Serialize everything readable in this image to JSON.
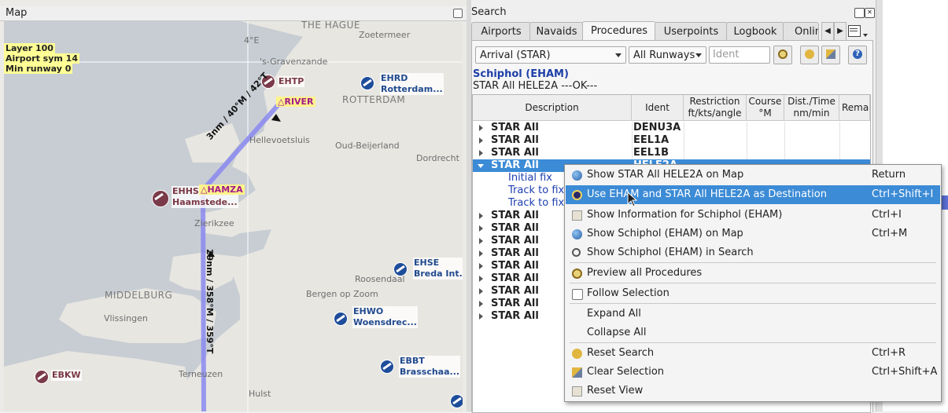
{
  "map": {
    "title": "Map",
    "info": [
      "Layer 100",
      "Airport sym 14",
      "Min runway 0"
    ],
    "grid_label": "4°E",
    "cities": [
      "THE HAGUE",
      "ROTTERDAM",
      "MIDDELBURG"
    ],
    "places": [
      "Zoetermeer",
      "'s-Gravenzande",
      "Hellevoetsluis",
      "Oud-Beijerland",
      "Dordrecht",
      "Zierikzee",
      "Roosendaal",
      "Bergen op Zoom",
      "Vlissingen",
      "Terneuzen",
      "Hulst"
    ],
    "airports": [
      {
        "code": "EHTP",
        "name": ""
      },
      {
        "code": "EHRD",
        "name": "Rotterdam..."
      },
      {
        "code": "EHHS",
        "name": "Haamstede..."
      },
      {
        "code": "EHSE",
        "name": "Breda Int..."
      },
      {
        "code": "EHWO",
        "name": "Woensdrec..."
      },
      {
        "code": "EBBT",
        "name": "Brasschaa..."
      },
      {
        "code": "EBKW",
        "name": ""
      }
    ],
    "waypoints": [
      "RIVER",
      "HAMZA"
    ],
    "legs": [
      "3nm / 40°M / 42°T",
      "29nm / 358°M / 359°T"
    ]
  },
  "search": {
    "title": "Search",
    "tabs": [
      "Airports",
      "Navaids",
      "Procedures",
      "Userpoints",
      "Logbook",
      "Online"
    ],
    "active_tab": "Procedures",
    "filter_type": "Arrival (STAR)",
    "filter_runways": "All Runways",
    "ident_placeholder": "Ident",
    "airport_heading": "Schiphol (EHAM)",
    "status_line": "STAR All HELE2A  ---OK---",
    "columns": [
      "Description",
      "Ident",
      "Restriction ft/kts/angle",
      "Course °M",
      "Dist./Time nm/min",
      "Remar"
    ],
    "rows": [
      {
        "desc": "STAR  All",
        "ident": "DENU3A"
      },
      {
        "desc": "STAR  All",
        "ident": "EEL1A"
      },
      {
        "desc": "STAR  All",
        "ident": "EEL1B"
      },
      {
        "desc": "STAR  All",
        "ident": "HELE2A"
      }
    ],
    "subrows": [
      "Initial fix",
      "Track to fix",
      "Track to fix"
    ],
    "more_rows": [
      "STAR  All",
      "STAR  All",
      "STAR  All",
      "STAR  All",
      "STAR  All",
      "STAR  All",
      "STAR  All",
      "STAR  All",
      "STAR  All"
    ]
  },
  "context_menu": {
    "items": [
      {
        "label": "Show STAR All HELE2A on Map",
        "shortcut": "Return"
      },
      {
        "label": "Use EHAM and STAR All HELE2A as Destination",
        "shortcut": "Ctrl+Shift+I"
      },
      {
        "label": "Show Information for Schiphol (EHAM)",
        "shortcut": "Ctrl+I"
      },
      {
        "label": "Show Schiphol (EHAM) on Map",
        "shortcut": "Ctrl+M"
      },
      {
        "label": "Show Schiphol (EHAM) in Search",
        "shortcut": ""
      },
      {
        "label": "Preview all Procedures",
        "shortcut": ""
      },
      {
        "label": "Follow Selection",
        "shortcut": ""
      },
      {
        "label": "Expand All",
        "shortcut": ""
      },
      {
        "label": "Collapse All",
        "shortcut": ""
      },
      {
        "label": "Reset Search",
        "shortcut": "Ctrl+R"
      },
      {
        "label": "Clear Selection",
        "shortcut": "Ctrl+Shift+A"
      },
      {
        "label": "Reset View",
        "shortcut": ""
      }
    ]
  },
  "colors": {
    "selection": "#3c8bd6",
    "route": "#8a88f0",
    "waypoint": "#a0198a",
    "airport": "#1e4d9a"
  }
}
